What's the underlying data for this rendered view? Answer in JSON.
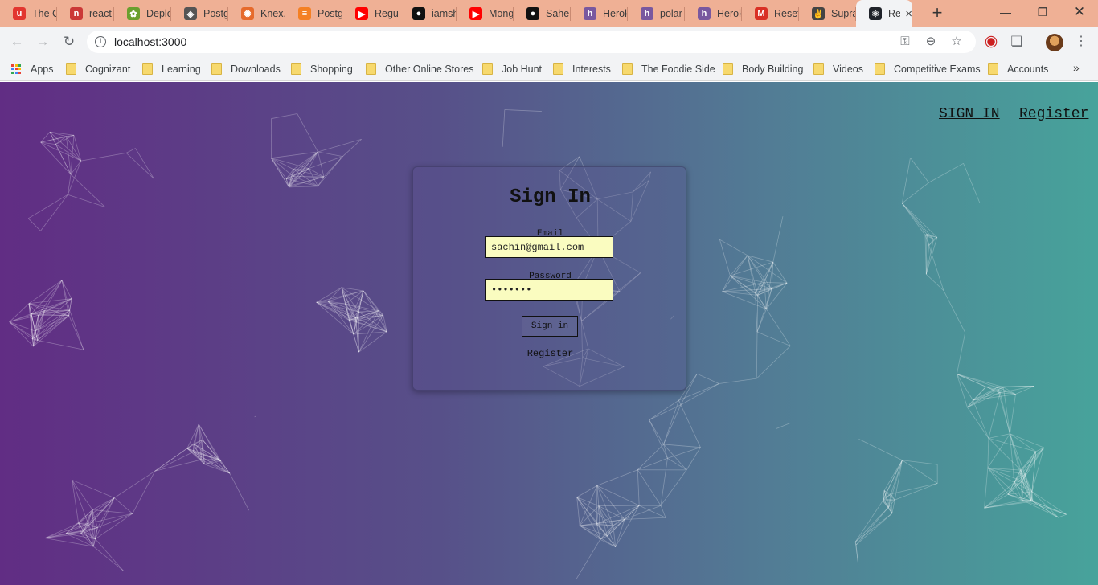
{
  "browser": {
    "tabs": [
      {
        "title": "The C",
        "icon": "udemy-icon",
        "color": "#e2362f",
        "glyph": "u"
      },
      {
        "title": "react-",
        "icon": "npm-icon",
        "color": "#cb3837",
        "glyph": "n"
      },
      {
        "title": "Deplo",
        "icon": "leaf-icon",
        "color": "#6a9f2e",
        "glyph": "✿"
      },
      {
        "title": "Postg",
        "icon": "postgres-icon",
        "color": "#555555",
        "glyph": "◈"
      },
      {
        "title": "Knex.",
        "icon": "knex-icon",
        "color": "#e66a2c",
        "glyph": "✺"
      },
      {
        "title": "Postg",
        "icon": "stackoverflow-icon",
        "color": "#f48024",
        "glyph": "≡"
      },
      {
        "title": "Regul",
        "icon": "youtube-icon",
        "color": "#ff0000",
        "glyph": "▶"
      },
      {
        "title": "iamsh",
        "icon": "github-icon",
        "color": "#111111",
        "glyph": "●"
      },
      {
        "title": "Mong",
        "icon": "youtube-icon",
        "color": "#ff0000",
        "glyph": "▶"
      },
      {
        "title": "Saheb",
        "icon": "github-icon",
        "color": "#111111",
        "glyph": "●"
      },
      {
        "title": "Herok",
        "icon": "heroku-icon",
        "color": "#79589f",
        "glyph": "h"
      },
      {
        "title": "polar",
        "icon": "heroku-icon",
        "color": "#79589f",
        "glyph": "h"
      },
      {
        "title": "Herok",
        "icon": "heroku-icon",
        "color": "#79589f",
        "glyph": "h"
      },
      {
        "title": "Reset",
        "icon": "gmail-icon",
        "color": "#d93025",
        "glyph": "M"
      },
      {
        "title": "Supra",
        "icon": "peace-icon",
        "color": "#444444",
        "glyph": "✌"
      },
      {
        "title": "Re",
        "icon": "react-icon",
        "color": "#20232a",
        "glyph": "⚛",
        "active": true
      }
    ],
    "url": "localhost:3000",
    "bookmarks": [
      {
        "label": "Apps",
        "icon": "apps-icon"
      },
      {
        "label": "Cognizant",
        "icon": "folder-icon"
      },
      {
        "label": "Learning",
        "icon": "folder-icon"
      },
      {
        "label": "Downloads",
        "icon": "folder-icon"
      },
      {
        "label": "Shopping",
        "icon": "folder-icon"
      },
      {
        "label": "Other Online Stores",
        "icon": "folder-icon"
      },
      {
        "label": "Job Hunt",
        "icon": "folder-icon"
      },
      {
        "label": "Interests",
        "icon": "folder-icon"
      },
      {
        "label": "The Foodie Side",
        "icon": "folder-icon"
      },
      {
        "label": "Body Building",
        "icon": "folder-icon"
      },
      {
        "label": "Videos",
        "icon": "folder-icon"
      },
      {
        "label": "Competitive Exams",
        "icon": "folder-icon"
      },
      {
        "label": "Accounts",
        "icon": "folder-icon"
      }
    ],
    "bookmarks_more": "»"
  },
  "page": {
    "nav": {
      "signin": "SIGN IN",
      "register": "Register"
    },
    "form": {
      "title": "Sign In",
      "email_label": "Email",
      "email_value": "sachin@gmail.com",
      "password_label": "Password",
      "password_value": "•••••••",
      "submit_label": "Sign in",
      "register_link": "Register"
    }
  },
  "colors": {
    "gradient_start": "#612d84",
    "gradient_end": "#47a39b",
    "input_background": "#fafcc0",
    "tabstrip": "#efb095"
  }
}
